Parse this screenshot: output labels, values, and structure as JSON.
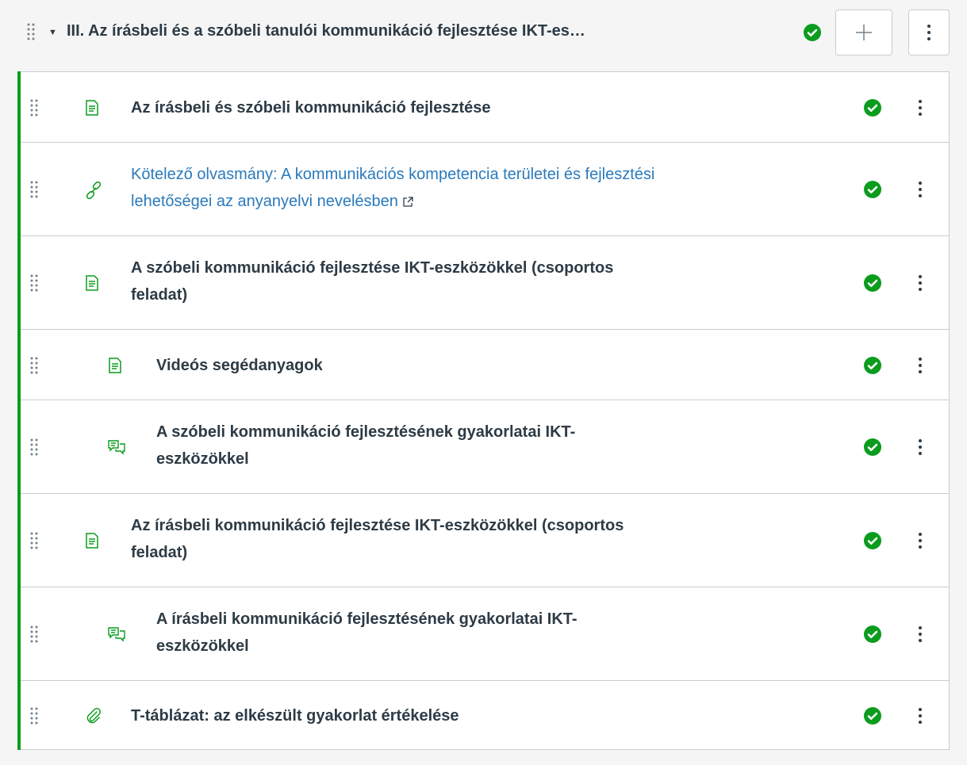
{
  "module": {
    "title": "III. Az írásbeli és a szóbeli tanulói kommunikáció fejlesztése IKT-es…",
    "published": true,
    "colors": {
      "published": "#0b9c1d",
      "link": "#2b7abc",
      "text": "#2d3b45",
      "border": "#c7cdd1",
      "icon": "#0b9c1d"
    }
  },
  "items": [
    {
      "title": "Az írásbeli és szóbeli kommunikáció fejlesztése",
      "icon": "page-icon",
      "published": true
    },
    {
      "title_line1": "Kötelező olvasmány: A kommunikációs kompetencia területei és fejlesztési",
      "title_line2": "lehetőségei az anyanyelvi nevelésben",
      "icon": "link-icon",
      "external": true,
      "published": true
    },
    {
      "title_line1": "A szóbeli kommunikáció fejlesztése IKT-eszközökkel (csoportos",
      "title_line2": "feladat)",
      "icon": "page-icon",
      "published": true
    },
    {
      "title": "Videós segédanyagok",
      "icon": "page-icon",
      "published": true
    },
    {
      "title_line1": "A szóbeli kommunikáció fejlesztésének gyakorlatai IKT-",
      "title_line2": "eszközökkel",
      "icon": "discussion-icon",
      "published": true
    },
    {
      "title_line1": "Az írásbeli kommunikáció fejlesztése IKT-eszközökkel (csoportos",
      "title_line2": "feladat)",
      "icon": "page-icon",
      "published": true
    },
    {
      "title_line1": "A írásbeli kommunikáció fejlesztésének gyakorlatai IKT-",
      "title_line2": "eszközökkel",
      "icon": "discussion-icon",
      "published": true
    },
    {
      "title": "T-táblázat: az elkészült gyakorlat értékelése",
      "icon": "attachment-icon",
      "published": true
    }
  ]
}
